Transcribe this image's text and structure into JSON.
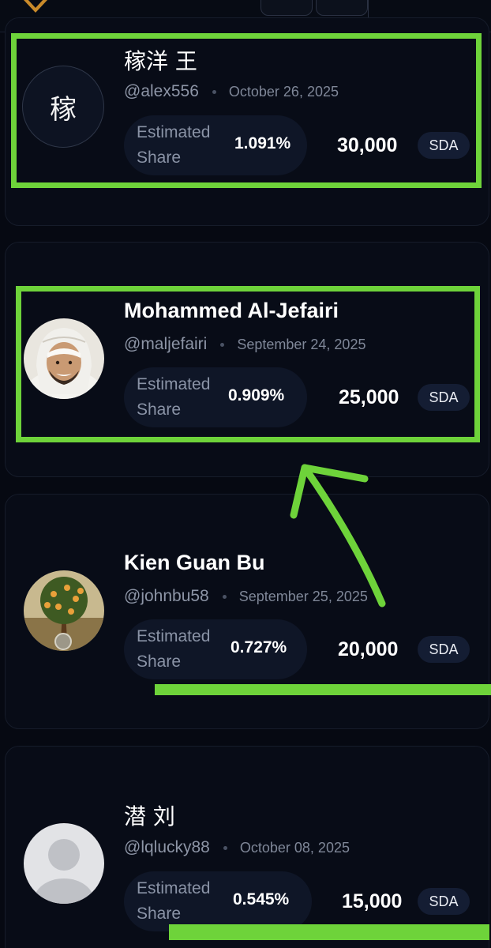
{
  "header": {
    "logo_icon": "brand-logo-icon",
    "buttons": [
      "settings-icon",
      "wallet-icon"
    ]
  },
  "share_label": "Estimated Share",
  "currency": "SDA",
  "entries": [
    {
      "name": "稼洋 王",
      "avatar_text": "稼",
      "handle": "@alex556",
      "date": "October 26, 2025",
      "share_percent": "1.091%",
      "amount": "30,000"
    },
    {
      "name": "Mohammed Al-Jefairi",
      "avatar_icon": "profile-photo",
      "handle": "@maljefairi",
      "date": "September 24, 2025",
      "share_percent": "0.909%",
      "amount": "25,000"
    },
    {
      "name": "Kien Guan Bu",
      "avatar_icon": "money-tree-avatar",
      "handle": "@johnbu58",
      "date": "September 25, 2025",
      "share_percent": "0.727%",
      "amount": "20,000"
    },
    {
      "name": "潜 刘",
      "avatar_icon": "default-user-avatar",
      "handle": "@lqlucky88",
      "date": "October 08, 2025",
      "share_percent": "0.545%",
      "amount": "15,000"
    }
  ],
  "annotations": {
    "highlight_color": "#6ed33a",
    "items": [
      "highlight-box",
      "highlight-box",
      "arrow",
      "underline",
      "underline"
    ]
  }
}
